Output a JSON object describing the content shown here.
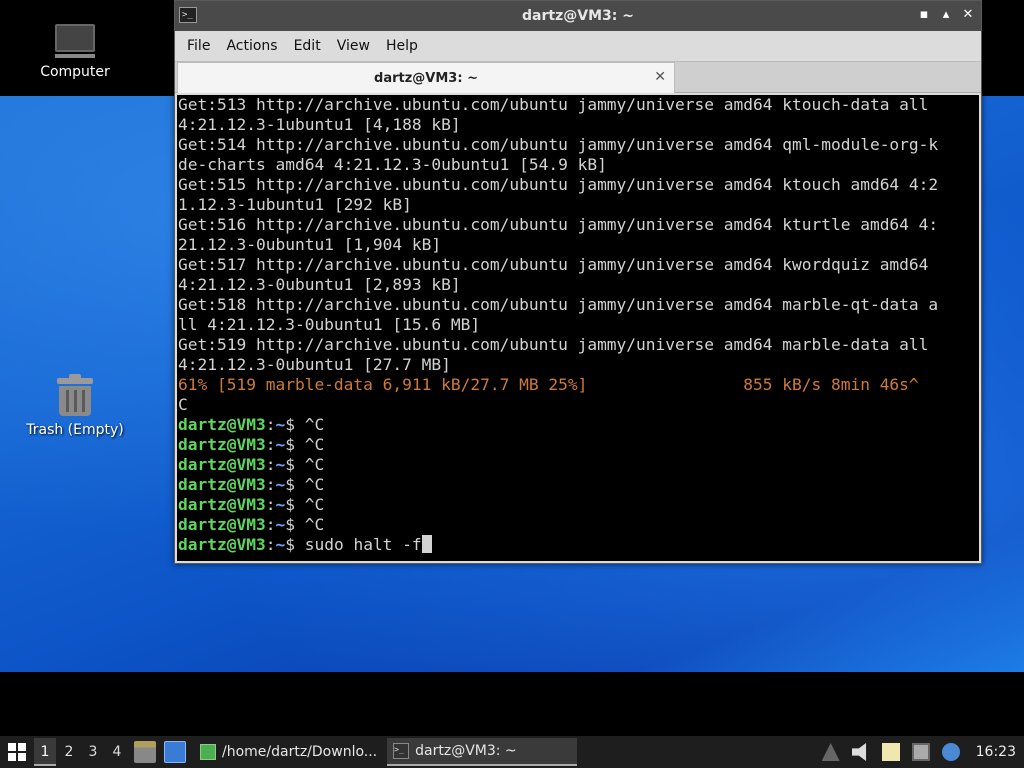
{
  "desktop": {
    "icons": [
      {
        "label": "Computer"
      },
      {
        "label": "Trash (Empty)"
      }
    ]
  },
  "window": {
    "title": "dartz@VM3: ~",
    "menu": [
      "File",
      "Actions",
      "Edit",
      "View",
      "Help"
    ],
    "tab_label": "dartz@VM3: ~",
    "controls": {
      "minimize": "▪",
      "maximize": "▴",
      "close": "✕"
    }
  },
  "terminal": {
    "lines": [
      "Get:513 http://archive.ubuntu.com/ubuntu jammy/universe amd64 ktouch-data all",
      "4:21.12.3-1ubuntu1 [4,188 kB]",
      "Get:514 http://archive.ubuntu.com/ubuntu jammy/universe amd64 qml-module-org-k",
      "de-charts amd64 4:21.12.3-0ubuntu1 [54.9 kB]",
      "Get:515 http://archive.ubuntu.com/ubuntu jammy/universe amd64 ktouch amd64 4:2",
      "1.12.3-1ubuntu1 [292 kB]",
      "Get:516 http://archive.ubuntu.com/ubuntu jammy/universe amd64 kturtle amd64 4:",
      "21.12.3-0ubuntu1 [1,904 kB]",
      "Get:517 http://archive.ubuntu.com/ubuntu jammy/universe amd64 kwordquiz amd64",
      "4:21.12.3-0ubuntu1 [2,893 kB]",
      "Get:518 http://archive.ubuntu.com/ubuntu jammy/universe amd64 marble-qt-data a",
      "ll 4:21.12.3-0ubuntu1 [15.6 MB]",
      "Get:519 http://archive.ubuntu.com/ubuntu jammy/universe amd64 marble-data all",
      "4:21.12.3-0ubuntu1 [27.7 MB]"
    ],
    "progress_line": "61% [519 marble-data 6,911 kB/27.7 MB 25%]                855 kB/s 8min 46s^",
    "after_progress": "C",
    "prompt_user": "dartz@VM3",
    "prompt_sep": ":",
    "prompt_path": "~",
    "prompt_symbol": "$ ",
    "history": [
      "^C",
      "^C",
      "^C",
      "^C",
      "^C",
      "^C"
    ],
    "current_command": "sudo halt -f"
  },
  "panel": {
    "workspaces": [
      "1",
      "2",
      "3",
      "4"
    ],
    "active_workspace": "1",
    "tasks": [
      {
        "label": "/home/dartz/Downlo..."
      },
      {
        "label": "dartz@VM3: ~"
      }
    ],
    "clock": "16:23"
  }
}
